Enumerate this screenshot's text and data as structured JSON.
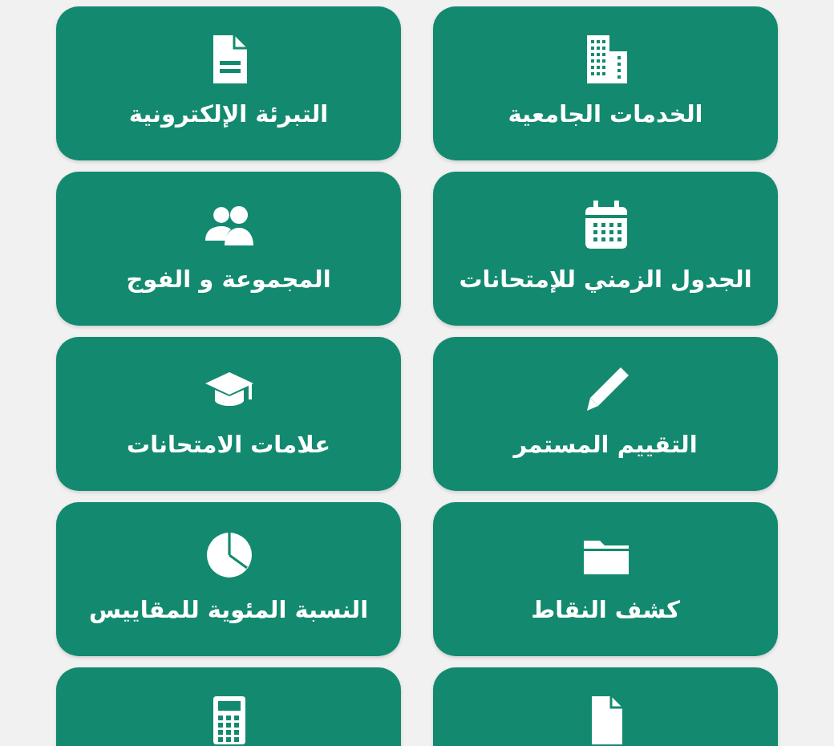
{
  "tiles": [
    {
      "kind": "labeled",
      "label": "الخدمات الجامعية"
    },
    {
      "kind": "labeled",
      "label": "التبرئة الإلكترونية"
    },
    {
      "kind": "labeled",
      "label": "الجدول الزمني للإمتحانات"
    },
    {
      "kind": "labeled",
      "label": "المجموعة و الفوج"
    },
    {
      "kind": "labeled",
      "label": "التقييم المستمر"
    },
    {
      "kind": "labeled",
      "label": "علامات الامتحانات"
    },
    {
      "kind": "labeled",
      "label": "كشف النقاط"
    },
    {
      "kind": "labeled",
      "label": "النسبة المئوية للمقاييس"
    },
    {
      "kind": "icon-only"
    },
    {
      "kind": "icon-only"
    }
  ]
}
